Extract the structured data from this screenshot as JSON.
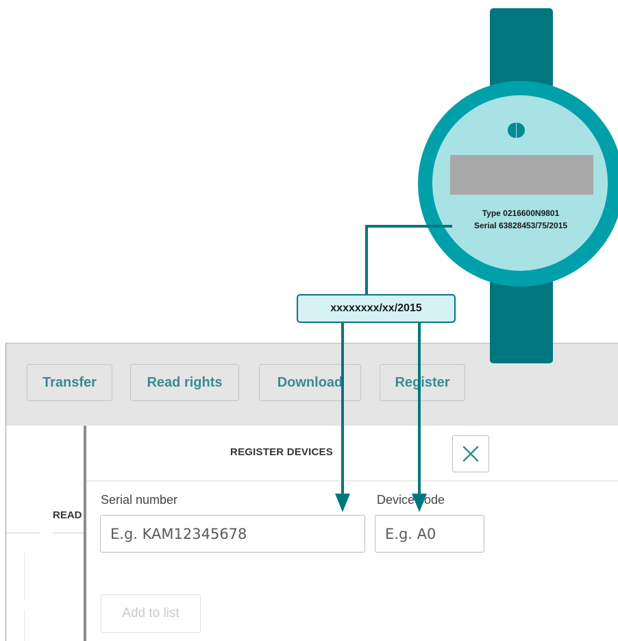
{
  "toolbar": {
    "transfer_label": "Transfer",
    "read_rights_label": "Read rights",
    "download_label": "Download",
    "register_label": "Register"
  },
  "left_panel": {
    "column_label": "READ"
  },
  "dialog": {
    "title": "REGISTER DEVICES",
    "close_icon": "close-x-icon",
    "serial_number": {
      "label": "Serial number",
      "placeholder": "E.g. KAM12345678",
      "value": ""
    },
    "device_code": {
      "label": "Device code",
      "placeholder": "E.g. A0",
      "value": ""
    },
    "add_to_list_label": "Add to list"
  },
  "meter": {
    "type_text": "Type 0216600N9801",
    "serial_text": "Serial 63828453/75/2015",
    "logo_icon": "kamstrup-logo-icon"
  },
  "callout": {
    "text": "xxxxxxxx/xx/2015"
  },
  "colors": {
    "accent_teal": "#00777f",
    "ring_teal": "#00a0aa",
    "face": "#a8e2e4",
    "button_text": "#3a8a93",
    "toolbar_bg": "#e5e5e5"
  }
}
